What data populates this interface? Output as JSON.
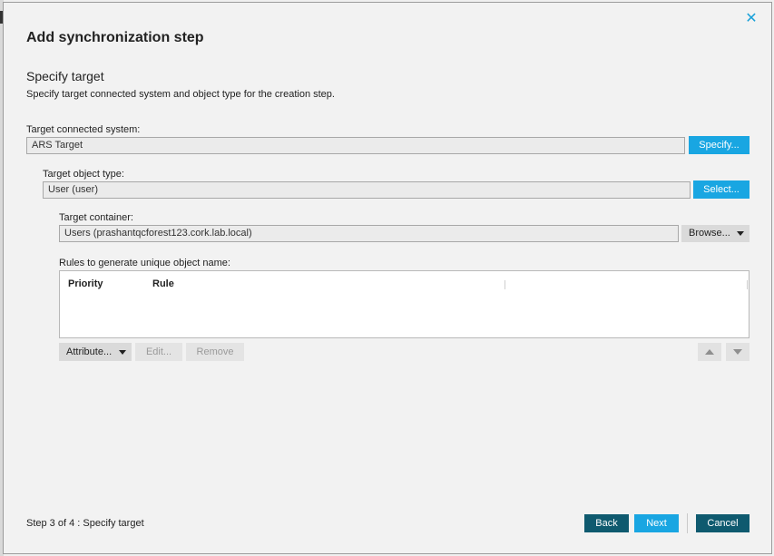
{
  "dialog": {
    "title": "Add synchronization step",
    "close_icon": "close-icon",
    "section_title": "Specify target",
    "section_description": "Specify target connected system and object type for the creation step."
  },
  "target_system": {
    "label": "Target connected system:",
    "value": "ARS Target",
    "button": "Specify..."
  },
  "object_type": {
    "label": "Target object type:",
    "value": "User (user)",
    "button": "Select..."
  },
  "container": {
    "label": "Target container:",
    "value": "Users (prashantqcforest123.cork.lab.local)",
    "button": "Browse...",
    "button_icon": "chevron-down-icon"
  },
  "rules": {
    "label": "Rules to generate unique object name:",
    "columns": [
      "Priority",
      "Rule"
    ],
    "rows": [],
    "buttons": {
      "attribute": "Attribute...",
      "edit": "Edit...",
      "remove": "Remove"
    },
    "move_up_icon": "arrow-up-icon",
    "move_down_icon": "arrow-down-icon"
  },
  "footer": {
    "step_text": "Step 3 of 4 : Specify target",
    "back": "Back",
    "next": "Next",
    "cancel": "Cancel"
  },
  "colors": {
    "accent_blue": "#19a6e2",
    "dark_teal": "#0f5a6f",
    "close_icon": "#1aa1d9"
  }
}
